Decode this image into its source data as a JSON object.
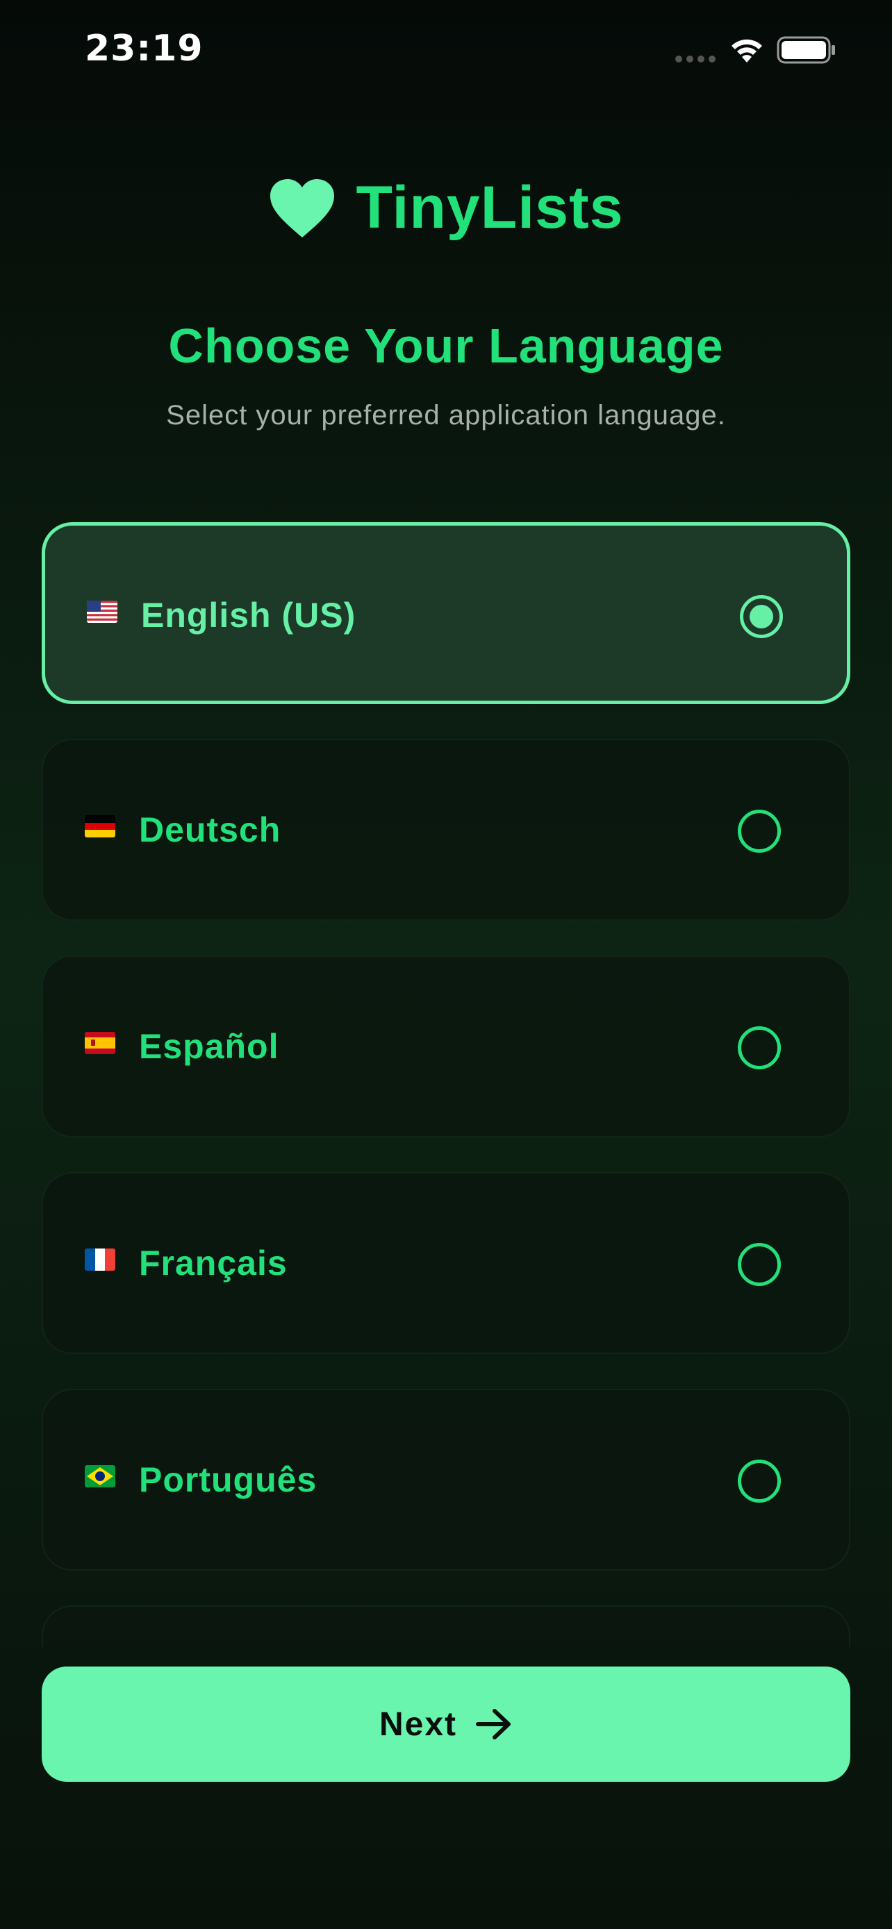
{
  "status_bar": {
    "time": "23:19",
    "icons": [
      "signal-dots-icon",
      "wifi-icon",
      "battery-icon"
    ]
  },
  "app": {
    "name": "TinyLists",
    "logo_icon": "heart-icon"
  },
  "header": {
    "title": "Choose Your Language",
    "subtitle": "Select your preferred application language."
  },
  "languages": [
    {
      "label": "English (US)",
      "flag": "us-flag-icon",
      "selected": true
    },
    {
      "label": "Deutsch",
      "flag": "de-flag-icon",
      "selected": false
    },
    {
      "label": "Español",
      "flag": "es-flag-icon",
      "selected": false
    },
    {
      "label": "Français",
      "flag": "fr-flag-icon",
      "selected": false
    },
    {
      "label": "Português",
      "flag": "br-flag-icon",
      "selected": false
    }
  ],
  "next_button": {
    "label": "Next",
    "icon": "arrow-right-icon"
  },
  "colors": {
    "accent": "#22e07a",
    "accent_light": "#66f0a6",
    "button_bg": "#6af5ae",
    "background": "#0a1a0f",
    "subtitle": "#a8b0aa"
  }
}
